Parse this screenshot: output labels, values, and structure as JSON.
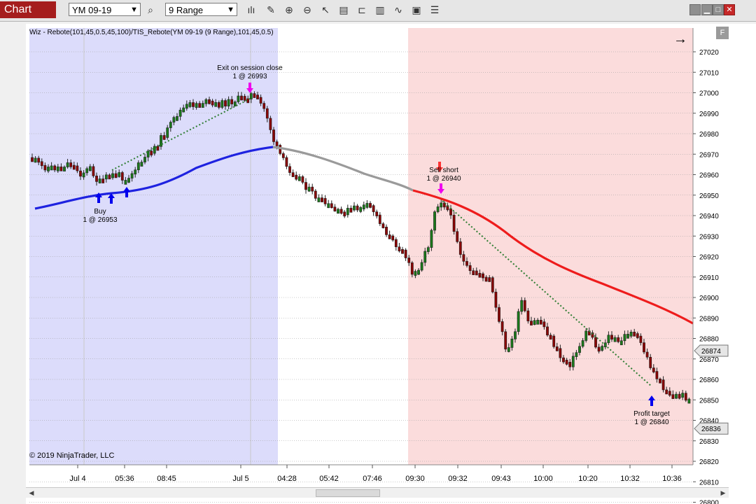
{
  "window": {
    "title": "Chart",
    "instrument": "YM 09-19",
    "interval": "9 Range"
  },
  "toolbar": {
    "icons": [
      "search-icon",
      "bar-type-icon",
      "pencil-icon",
      "zoom-in-icon",
      "zoom-out-icon",
      "pointer-icon",
      "data-box-icon",
      "time-frame-icon",
      "indicators-icon",
      "strategies-icon",
      "properties-icon",
      "list-icon"
    ]
  },
  "chart": {
    "info_label": "Wiz - Rebote(101,45,0.5,45,100)/TIS_Rebote(YM 09-19 (9 Range),101,45,0.5)",
    "copyright": "© 2019 NinjaTrader, LLC",
    "price_labels": [
      "27020",
      "27010",
      "27000",
      "26990",
      "26980",
      "26970",
      "26960",
      "26950",
      "26940",
      "26930",
      "26920",
      "26910",
      "26900",
      "26890",
      "26880",
      "26870",
      "26860",
      "26850",
      "26840",
      "26830",
      "26820",
      "26810",
      "26800"
    ],
    "current_price_labels": [
      "26874",
      "26836"
    ],
    "time_labels": [
      "Jul 4",
      "05:36",
      "08:45",
      "Jul 5",
      "04:28",
      "05:42",
      "07:46",
      "09:30",
      "09:32",
      "09:43",
      "10:00",
      "10:20",
      "10:32",
      "10:36"
    ],
    "annotations": {
      "buy": {
        "line1": "Buy",
        "line2": "1 @ 26953"
      },
      "exit": {
        "line1": "Exit on session close",
        "line2": "1 @ 26993"
      },
      "sell": {
        "line1": "Sell short",
        "line2": "1 @ 26940"
      },
      "target": {
        "line1": "Profit target",
        "line2": "1 @ 26840"
      }
    },
    "colors": {
      "long_session": "#dcdcfb",
      "short_session": "#fbdcdc",
      "ma_blue": "#1e22e0",
      "ma_gray": "#9a9a9a",
      "ma_red": "#ee1c1c",
      "up_candle": "#1a7a1a",
      "down_candle": "#8b0000",
      "entry_arrow": "#0000ee",
      "exit_arrow": "#ee00ee"
    }
  }
}
